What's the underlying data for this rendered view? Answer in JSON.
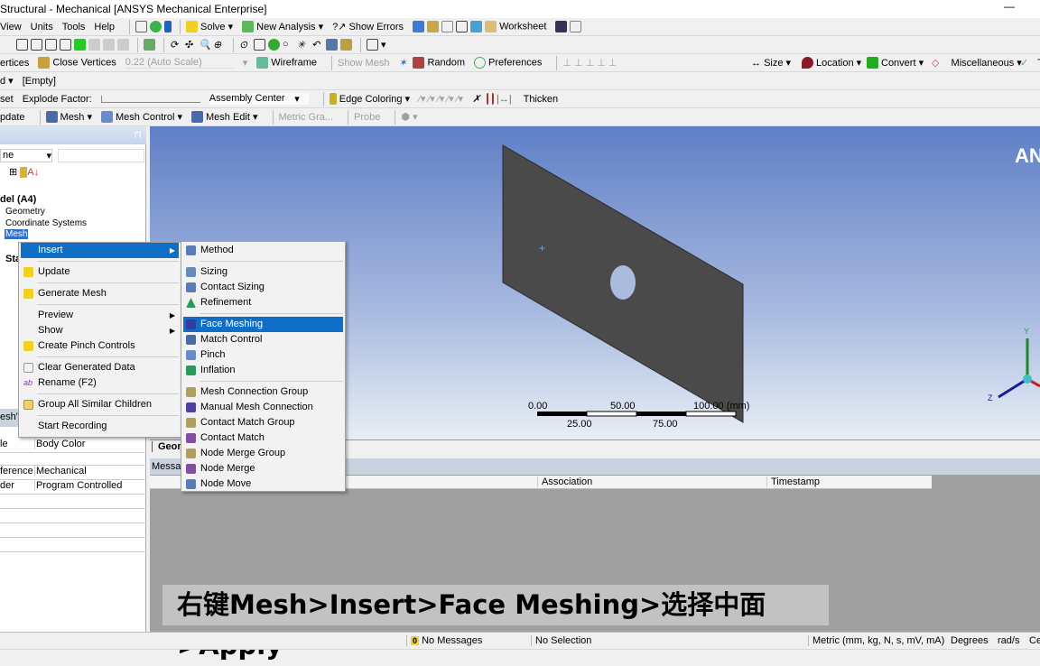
{
  "window": {
    "title": "Structural - Mechanical [ANSYS Mechanical Enterprise]",
    "minimize": "—"
  },
  "menubar": [
    "View",
    "Units",
    "Tools",
    "Help"
  ],
  "toolbar1": {
    "solve": "Solve",
    "new_analysis": "New Analysis",
    "show_errors": "?↗ Show Errors",
    "worksheet": "Worksheet"
  },
  "toolbar3": {
    "vertices": "ertices",
    "close_vertices": "Close Vertices",
    "scale": "0.22 (Auto Scale)",
    "wireframe": "Wireframe",
    "show_mesh": "Show Mesh",
    "random": "Random",
    "preferences": "Preferences",
    "size": "Size",
    "location": "Location",
    "convert": "Convert",
    "miscellaneous": "Miscellaneous",
    "t": "T"
  },
  "toolbar4": {
    "selector": "d",
    "empty": "[Empty]"
  },
  "toolbar5": {
    "reset": "set",
    "explode_factor": "Explode Factor:",
    "assembly_center": "Assembly Center",
    "edge_coloring": "Edge Coloring",
    "thicken": "Thicken"
  },
  "toolbar6": {
    "update": "pdate",
    "mesh": "Mesh",
    "mesh_control": "Mesh Control",
    "mesh_edit": "Mesh Edit",
    "metric_graph": "Metric Gra...",
    "probe": "Probe"
  },
  "outline": {
    "filter": "ne",
    "items": [
      "del (A4)",
      "Geometry",
      "Coordinate Systems",
      "Mesh",
      "Sta"
    ]
  },
  "details": {
    "header": "esh\"",
    "rows": [
      [
        "le",
        "Body Color"
      ],
      [
        "ference",
        "Mechanical"
      ],
      [
        "der",
        "Program Controlled"
      ]
    ]
  },
  "context_menu": [
    "Insert",
    "Update",
    "Generate Mesh",
    "Preview",
    "Show",
    "Create Pinch Controls",
    "Clear Generated Data",
    "Rename (F2)",
    "Group All Similar Children",
    "Start Recording"
  ],
  "submenu": [
    "Method",
    "Sizing",
    "Contact Sizing",
    "Refinement",
    "Face Meshing",
    "Match Control",
    "Pinch",
    "Inflation",
    "Mesh Connection Group",
    "Manual Mesh Connection",
    "Contact Match Group",
    "Contact Match",
    "Node Merge Group",
    "Node Merge",
    "Node Move"
  ],
  "graphics": {
    "logo": "AN",
    "scale_top": [
      "0.00",
      "50.00",
      "100.00 (mm)"
    ],
    "scale_bottom": [
      "25.00",
      "75.00"
    ],
    "axis_y": "Y",
    "axis_z": "Z",
    "tab": "Geom"
  },
  "messages": {
    "title": "Messag",
    "columns": [
      "Association",
      "Timestamp"
    ]
  },
  "caption": "右键Mesh>Insert>Face Meshing>选择中面>Apply",
  "statusbar": {
    "messages": "No Messages",
    "messages_count": "0",
    "selection": "No Selection",
    "units": "Metric (mm, kg, N, s, mV, mA)",
    "angle": "Degrees",
    "rot": "rad/s",
    "temp": "Ce"
  }
}
